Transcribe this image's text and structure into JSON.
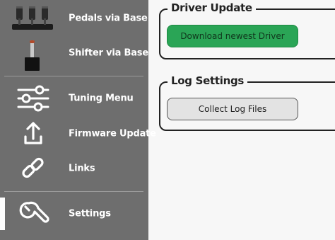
{
  "sidebar": {
    "items": [
      {
        "label": "Pedals via Base",
        "icon": "pedals-icon"
      },
      {
        "label": "Shifter via Base",
        "icon": "shifter-icon"
      },
      {
        "label": "Tuning Menu",
        "icon": "sliders-icon"
      },
      {
        "label": "Firmware Update",
        "icon": "upload-icon"
      },
      {
        "label": "Links",
        "icon": "link-icon"
      },
      {
        "label": "Settings",
        "icon": "wrench-icon"
      }
    ],
    "active_item": "Settings"
  },
  "driver_update": {
    "title": "Driver Update",
    "download_label": "Download newest Driver"
  },
  "log_settings": {
    "title": "Log Settings",
    "collect_label": "Collect Log Files"
  },
  "colors": {
    "sidebar_bg": "#6e6e6e",
    "primary_button": "#2aa556",
    "secondary_button": "#e3e3e3"
  }
}
